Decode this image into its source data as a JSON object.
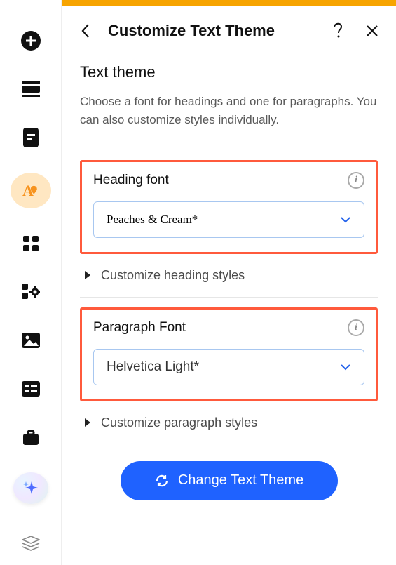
{
  "header": {
    "title": "Customize Text Theme"
  },
  "section": {
    "title": "Text theme",
    "description": "Choose a font for headings and one for paragraphs. You can also customize styles individually."
  },
  "heading_font": {
    "label": "Heading font",
    "value": "Peaches & Cream*",
    "expand_label": "Customize heading styles"
  },
  "paragraph_font": {
    "label": "Paragraph Font",
    "value": "Helvetica Light*",
    "expand_label": "Customize paragraph styles"
  },
  "change_button": "Change Text Theme"
}
